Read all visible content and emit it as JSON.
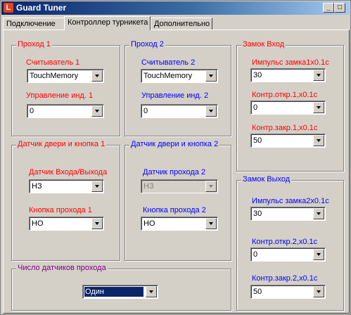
{
  "window": {
    "title": "Guard Tuner",
    "minimize": "_",
    "maximize": "□",
    "close": "×"
  },
  "tabs": [
    "Подключение",
    "Контроллер турникета",
    "Дополнительно"
  ],
  "pass1": {
    "title": "Проход 1",
    "reader_label": "Считыватель 1",
    "reader_value": "TouchMemory",
    "ind_label": "Управление инд. 1",
    "ind_value": "0"
  },
  "pass2": {
    "title": "Проход 2",
    "reader_label": "Считыватель 2",
    "reader_value": "TouchMemory",
    "ind_label": "Управление инд. 2",
    "ind_value": "0"
  },
  "door1": {
    "title": "Датчик двери и кнопка 1",
    "sensor_label": "Датчик Входа/Выхода",
    "sensor_value": "НЗ",
    "button_label": "Кнопка прохода 1",
    "button_value": "НО"
  },
  "door2": {
    "title": "Датчик двери и кнопка 2",
    "sensor_label": "Датчик  прохода 2",
    "sensor_value": "НЗ",
    "button_label": "Кнопка прохода 2",
    "button_value": "НО"
  },
  "sensors_count": {
    "title": "Число датчиков прохода",
    "value": "Один"
  },
  "lock_in": {
    "title": "Замок Вход",
    "pulse_label": "Импульс замка1x0.1c",
    "pulse_value": "30",
    "open_label": "Контр.откр.1,x0.1c",
    "open_value": "0",
    "close_label": "Контр.закр.1,x0.1c",
    "close_value": "50"
  },
  "lock_out": {
    "title": "Замок Выход",
    "pulse_label": "Импульс замка2x0.1c",
    "pulse_value": "30",
    "open_label": "Контр.откр.2,x0.1c",
    "open_value": "0",
    "close_label": "Контр.закр.2,x0.1c",
    "close_value": "50"
  }
}
